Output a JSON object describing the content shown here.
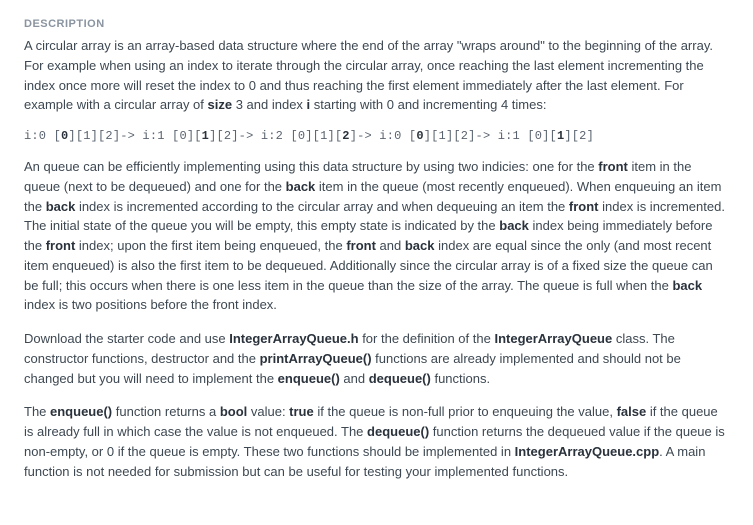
{
  "header": "DESCRIPTION",
  "para1": {
    "t1": "A circular array is an array-based data structure where the end of the array \"wraps around\" to the beginning of the array. For example when using an index to iterate through the circular array, once reaching the last element incrementing the index once more will reset the index to 0 and thus reaching the first element immediately after the last element. For example with a circular array of ",
    "b1": "size",
    "t2": " 3 and index ",
    "b2": "i",
    "t3": " starting with 0 and incrementing 4 times:"
  },
  "code": {
    "s1": "i:0 [",
    "b1": "0",
    "s2": "][1][2]-> i:1 [0][",
    "b2": "1",
    "s3": "][2]-> i:2 [0][1][",
    "b3": "2",
    "s4": "]-> i:0 [",
    "b4": "0",
    "s5": "][1][2]-> i:1 [0][",
    "b5": "1",
    "s6": "][2]"
  },
  "para2": {
    "t1": "An queue can be efficiently implementing using this data structure by using two indicies: one for the ",
    "b1": "front",
    "t2": " item in the queue (next to be dequeued) and one for the ",
    "b2": "back",
    "t3": " item in the queue (most recently enqueued). When enqueuing an item the ",
    "b3": "back",
    "t4": " index is incremented according to the circular array and when dequeuing an item the ",
    "b4": "front",
    "t5": " index is incremented. The initial state of the queue you will be empty, this empty state is indicated by the ",
    "b5": "back",
    "t6": " index being immediately before the ",
    "b6": "front",
    "t7": " index; upon the first item being enqueued, the ",
    "b7": "front",
    "t8": " and ",
    "b8": "back",
    "t9": " index are equal since the only (and most recent item enqueued) is also the first item to be dequeued. Additionally since the circular array is of a fixed size the queue can be full; this occurs when there is one less item in the queue than the size of the array. The queue is full when the ",
    "b9": "back",
    "t10": " index is two positions before the front index."
  },
  "para3": {
    "t1": "Download the starter code and use ",
    "b1": "IntegerArrayQueue.h",
    "t2": " for the definition of the ",
    "b2": "IntegerArrayQueue",
    "t3": " class. The constructor functions, destructor and the ",
    "b3": "printArrayQueue()",
    "t4": " functions are already implemented and should not be changed but you will need to implement the ",
    "b4": "enqueue()",
    "t5": " and ",
    "b5": "dequeue()",
    "t6": " functions."
  },
  "para4": {
    "t1": "The ",
    "b1": "enqueue()",
    "t2": " function returns a ",
    "b2": "bool",
    "t3": " value: ",
    "b3": "true",
    "t4": " if the queue is non-full prior to enqueuing the value, ",
    "b4": "false",
    "t5": " if the queue is already full in which case the value is not enqueued. The ",
    "b5": "dequeue()",
    "t6": " function returns the dequeued value if the queue is non-empty, or 0 if the queue is empty. These two functions should be implemented in ",
    "b6": "IntegerArrayQueue.cpp",
    "t7": ". A main function is not needed for submission but can be useful for testing your implemented functions."
  }
}
